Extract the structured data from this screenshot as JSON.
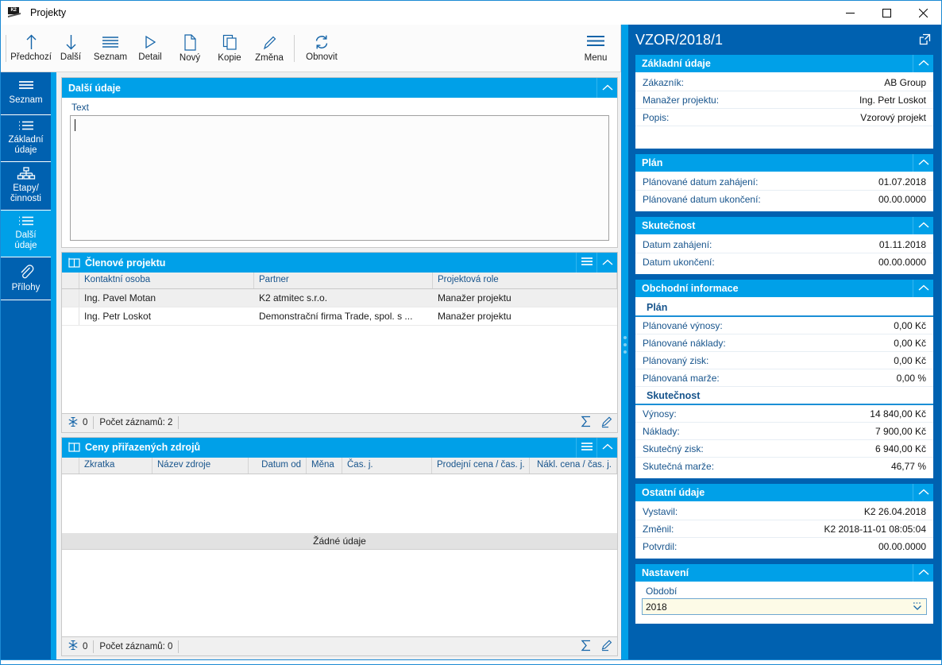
{
  "window": {
    "title": "Projekty",
    "app_icon": "k2-logo-icon",
    "minimize_label": "minimize-icon",
    "maximize_label": "maximize-icon",
    "close_label": "close-icon"
  },
  "toolbar": {
    "buttons": [
      {
        "label": "Předchozí",
        "icon": "arrow-up-icon"
      },
      {
        "label": "Další",
        "icon": "arrow-down-icon"
      },
      {
        "label": "Seznam",
        "icon": "list-icon"
      },
      {
        "label": "Detail",
        "icon": "play-triangle-icon"
      },
      {
        "label": "Nový",
        "icon": "document-new-icon"
      },
      {
        "label": "Kopie",
        "icon": "copy-icon"
      },
      {
        "label": "Změna",
        "icon": "pencil-icon"
      },
      {
        "label": "Obnovit",
        "icon": "refresh-icon"
      }
    ],
    "menu_label": "Menu",
    "menu_icon": "hamburger-icon"
  },
  "sidebar": {
    "items": [
      {
        "label": "Seznam",
        "icon": "list-icon",
        "active": false
      },
      {
        "label": "Základní\núdaje",
        "icon": "details-list-icon",
        "active": false
      },
      {
        "label": "Etapy/\nčinnosti",
        "icon": "org-tree-icon",
        "active": false
      },
      {
        "label": "Další\núdaje",
        "icon": "details-list-icon",
        "active": true
      },
      {
        "label": "Přílohy",
        "icon": "paperclip-icon",
        "active": false
      }
    ]
  },
  "main": {
    "panel_dalsi_udaje": {
      "title": "Další údaje",
      "collapse_icon": "chevron-up-icon",
      "text_label": "Text",
      "text_value": ""
    },
    "panel_clenove": {
      "title": "Členové projektu",
      "book_icon": "book-icon",
      "menu_icon": "hamburger-icon",
      "collapse_icon": "chevron-up-icon",
      "columns": [
        "Kontaktní osoba",
        "Partner",
        "Projektová role"
      ],
      "rows": [
        [
          "Ing. Pavel Motan",
          "K2 atmitec s.r.o.",
          "Manažer projektu"
        ],
        [
          "Ing. Petr Loskot",
          "Demonstrační firma Trade, spol. s ...",
          "Manažer projektu"
        ]
      ],
      "footer": {
        "filter_icon": "snowflake-icon",
        "filter_count": "0",
        "record_count": "Počet záznamů: 2",
        "sum_icon": "sigma-icon",
        "edit_icon": "pencil-icon"
      }
    },
    "panel_ceny": {
      "title": "Ceny přiřazených zdrojů",
      "book_icon": "book-icon",
      "menu_icon": "hamburger-icon",
      "collapse_icon": "chevron-up-icon",
      "columns": [
        "Zkratka",
        "Název zdroje",
        "Datum od",
        "Měna",
        "Čas. j.",
        "Prodejní cena / čas. j.",
        "Nákl. cena / čas. j."
      ],
      "empty_text": "Žádné údaje",
      "footer": {
        "filter_icon": "snowflake-icon",
        "filter_count": "0",
        "record_count": "Počet záznamů: 0",
        "sum_icon": "sigma-icon",
        "edit_icon": "pencil-icon"
      }
    }
  },
  "detail": {
    "title": "VZOR/2018/1",
    "expand_icon": "open-external-icon",
    "cards": [
      {
        "title": "Základní údaje",
        "collapse_icon": "chevron-up-icon",
        "rows": [
          {
            "key": "Zákazník:",
            "value": "AB Group"
          },
          {
            "key": "Manažer projektu:",
            "value": "Ing. Petr Loskot"
          },
          {
            "key": "Popis:",
            "value": "Vzorový projekt"
          }
        ],
        "has_pad": true
      },
      {
        "title": "Plán",
        "collapse_icon": "chevron-up-icon",
        "rows": [
          {
            "key": "Plánované datum zahájení:",
            "value": "01.07.2018"
          },
          {
            "key": "Plánované datum ukončení:",
            "value": "00.00.0000"
          }
        ]
      },
      {
        "title": "Skutečnost",
        "collapse_icon": "chevron-up-icon",
        "rows": [
          {
            "key": "Datum zahájení:",
            "value": "01.11.2018"
          },
          {
            "key": "Datum ukončení:",
            "value": "00.00.0000"
          }
        ]
      },
      {
        "title": "Obchodní informace",
        "collapse_icon": "chevron-up-icon",
        "sub1": "Plán",
        "rows1": [
          {
            "key": "Plánované výnosy:",
            "value": "0,00 Kč"
          },
          {
            "key": "Plánované náklady:",
            "value": "0,00 Kč"
          },
          {
            "key": "Plánovaný zisk:",
            "value": "0,00 Kč"
          },
          {
            "key": "Plánovaná marže:",
            "value": "0,00 %"
          }
        ],
        "sub2": "Skutečnost",
        "rows2": [
          {
            "key": "Výnosy:",
            "value": "14 840,00 Kč"
          },
          {
            "key": "Náklady:",
            "value": "7 900,00 Kč"
          },
          {
            "key": "Skutečný zisk:",
            "value": "6 940,00 Kč"
          },
          {
            "key": "Skutečná marže:",
            "value": "46,77 %"
          }
        ]
      },
      {
        "title": "Ostatní údaje",
        "collapse_icon": "chevron-up-icon",
        "rows": [
          {
            "key": "Vystavil:",
            "value": "K2 26.04.2018"
          },
          {
            "key": "Změnil:",
            "value": "K2 2018-11-01 08:05:04"
          },
          {
            "key": "Potvrdil:",
            "value": "00.00.0000"
          }
        ]
      }
    ],
    "settings_card": {
      "title": "Nastavení",
      "collapse_icon": "chevron-up-icon",
      "field_label": "Období",
      "field_value": "2018",
      "dropdown_icon": "chevron-down-icon"
    }
  },
  "colors": {
    "accent_dark": "#0061b0",
    "accent_light": "#00a0e8",
    "label_blue": "#17548c",
    "field_yellow": "#fdfbe7"
  }
}
